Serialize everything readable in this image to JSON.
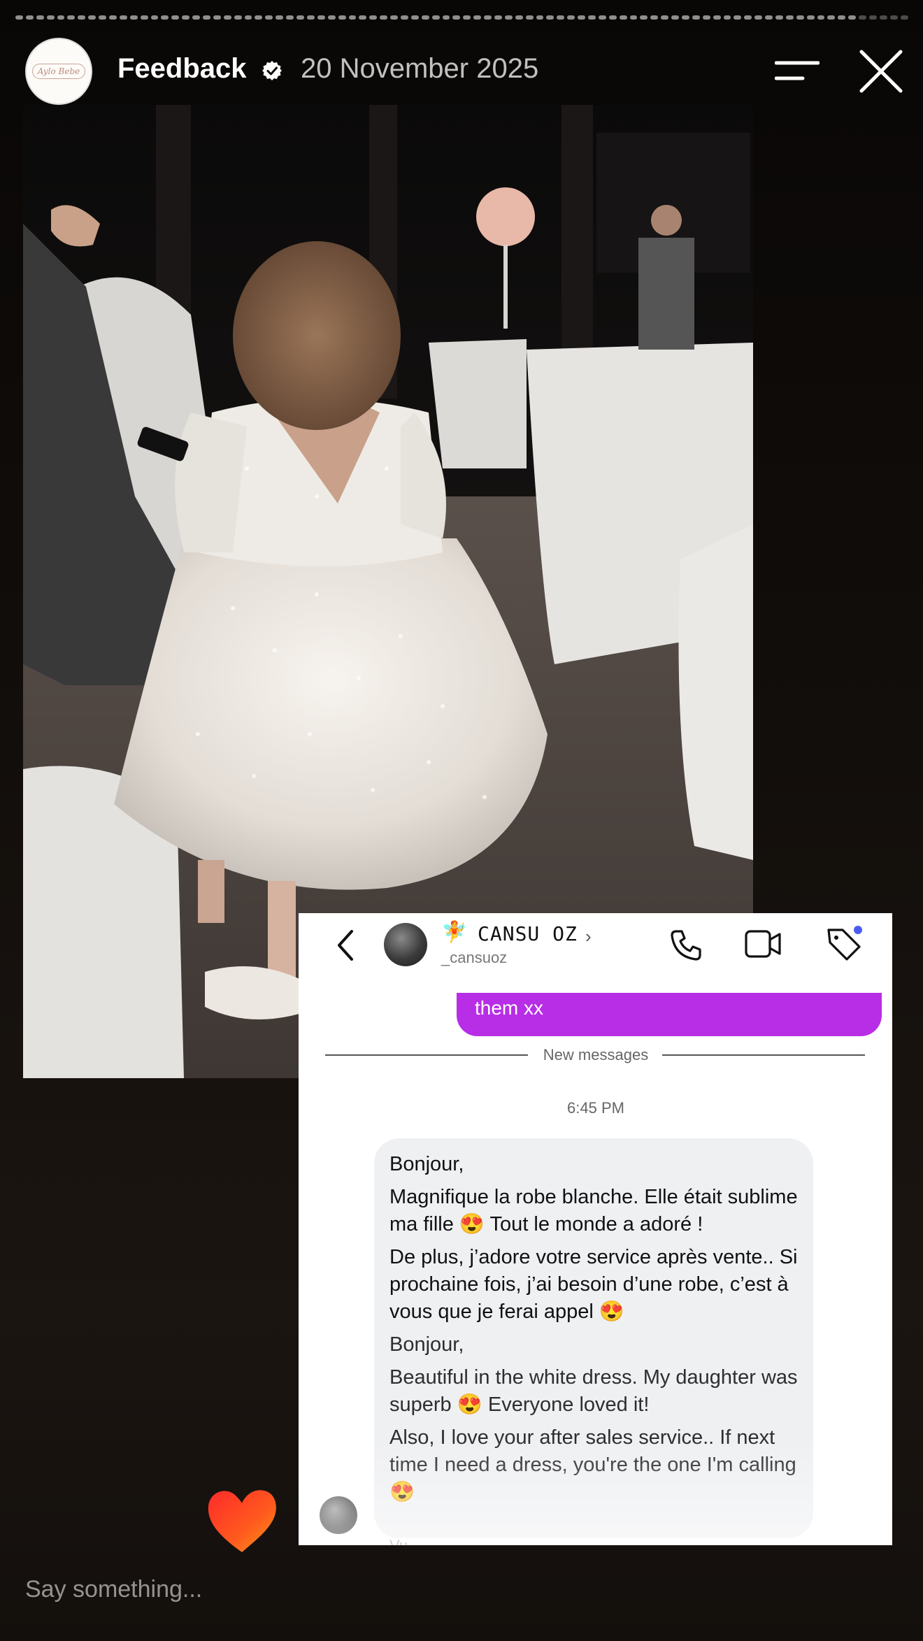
{
  "header": {
    "logo_text": "Aylo Bebe",
    "account_name": "Feedback",
    "date": "20 November 2025"
  },
  "dm": {
    "name_emoji": "🧚",
    "name": "CANSU OZ",
    "chevron": "›",
    "handle": "_cansuoz",
    "sent_message": "them xx",
    "divider_label": "New messages",
    "time": "6:45 PM",
    "message_fr": [
      "Bonjour,",
      "Magnifique la robe blanche. Elle était sublime ma fille 😍 Tout le monde a adoré !",
      "De plus, j’adore votre service après vente.. Si prochaine fois, j’ai besoin d’une robe, c’est à vous que je ferai appel 😍"
    ],
    "message_en": [
      "Bonjour,",
      "Beautiful in the white dress. My daughter was superb 😍 Everyone loved it!",
      "Also, I love your after sales service.. If next time I need a dress, you're the one I'm calling 😍"
    ],
    "seen_partial": "Vu"
  },
  "reply": {
    "placeholder": "Say something..."
  },
  "colors": {
    "accent_purple": "#b72ee6",
    "background": "#0e0b09",
    "bubble_gray": "#eff0f2"
  }
}
